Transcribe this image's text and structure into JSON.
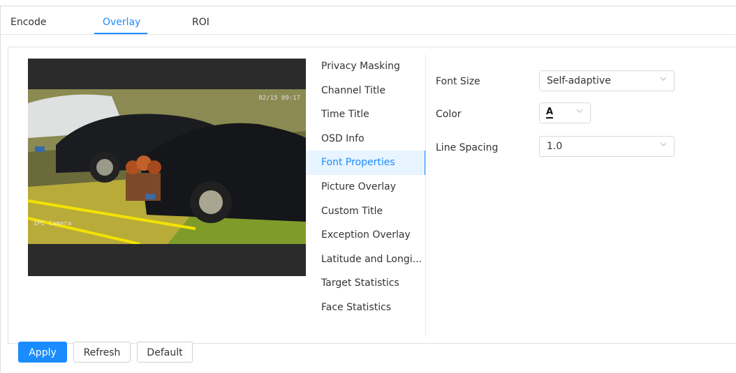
{
  "tabs": [
    {
      "label": "Encode"
    },
    {
      "label": "Overlay"
    },
    {
      "label": "ROI"
    }
  ],
  "menu": [
    {
      "label": "Privacy Masking"
    },
    {
      "label": "Channel Title"
    },
    {
      "label": "Time Title"
    },
    {
      "label": "OSD Info"
    },
    {
      "label": "Font Properties"
    },
    {
      "label": "Picture Overlay"
    },
    {
      "label": "Custom Title"
    },
    {
      "label": "Exception Overlay"
    },
    {
      "label": "Latitude and Longi..."
    },
    {
      "label": "Target Statistics"
    },
    {
      "label": "Face Statistics"
    }
  ],
  "form": {
    "font_size_label": "Font Size",
    "font_size_value": "Self-adaptive",
    "color_label": "Color",
    "color_value": "A",
    "line_spacing_label": "Line Spacing",
    "line_spacing_value": "1.0"
  },
  "buttons": {
    "apply": "Apply",
    "refresh": "Refresh",
    "default": "Default"
  },
  "colors": {
    "accent": "#1a8cff",
    "active_bg": "#e8f4ff"
  }
}
